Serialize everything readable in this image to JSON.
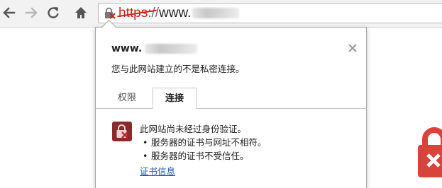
{
  "toolbar": {
    "back_icon": "arrow-left-icon",
    "forward_icon": "arrow-right-icon",
    "reload_icon": "reload-icon",
    "home_icon": "home-icon"
  },
  "omnibox": {
    "scheme": "https",
    "separator": "://",
    "host_prefix": "www.",
    "lock_icon": "broken-lock-icon"
  },
  "popup": {
    "site_name": "www.",
    "close_icon": "close-icon",
    "subtitle": "您与此网站建立的不是私密连接。",
    "tabs": [
      {
        "label": "权限",
        "selected": false
      },
      {
        "label": "连接",
        "selected": true
      }
    ],
    "connection": {
      "icon": "broken-lock-icon",
      "heading": "此网站尚未经过身份验证。",
      "bullets": [
        "服务器的证书与网址不相符。",
        "服务器的证书不受信任。"
      ],
      "bullet_char": "•",
      "link": "证书信息"
    }
  },
  "colors": {
    "error_red": "#cc2a1a",
    "link_blue": "#1a55c0",
    "icon_maroon": "#8b2a2a"
  }
}
